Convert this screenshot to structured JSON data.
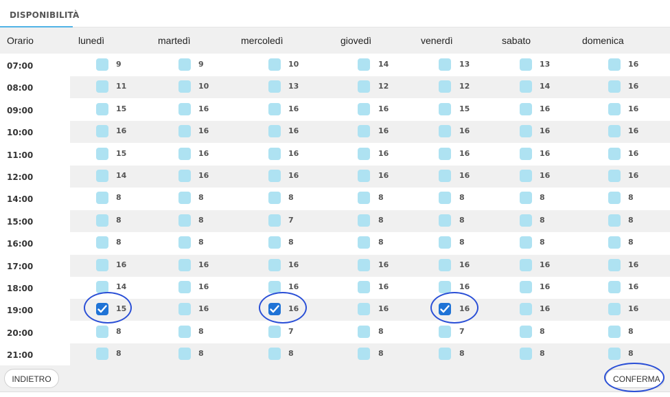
{
  "tab_label": "DISPONIBILITÀ",
  "table": {
    "time_header": "Orario",
    "days": [
      "lunedì",
      "martedì",
      "mercoledì",
      "giovedì",
      "venerdì",
      "sabato",
      "domenica"
    ],
    "rows": [
      {
        "time": "07:00",
        "counts": [
          "9",
          "9",
          "10",
          "14",
          "13",
          "13",
          "16"
        ],
        "checked": [
          false,
          false,
          false,
          false,
          false,
          false,
          false
        ]
      },
      {
        "time": "08:00",
        "counts": [
          "11",
          "10",
          "13",
          "12",
          "12",
          "14",
          "16"
        ],
        "checked": [
          false,
          false,
          false,
          false,
          false,
          false,
          false
        ]
      },
      {
        "time": "09:00",
        "counts": [
          "15",
          "16",
          "16",
          "16",
          "15",
          "16",
          "16"
        ],
        "checked": [
          false,
          false,
          false,
          false,
          false,
          false,
          false
        ]
      },
      {
        "time": "10:00",
        "counts": [
          "16",
          "16",
          "16",
          "16",
          "16",
          "16",
          "16"
        ],
        "checked": [
          false,
          false,
          false,
          false,
          false,
          false,
          false
        ]
      },
      {
        "time": "11:00",
        "counts": [
          "15",
          "16",
          "16",
          "16",
          "16",
          "16",
          "16"
        ],
        "checked": [
          false,
          false,
          false,
          false,
          false,
          false,
          false
        ]
      },
      {
        "time": "12:00",
        "counts": [
          "14",
          "16",
          "16",
          "16",
          "16",
          "16",
          "16"
        ],
        "checked": [
          false,
          false,
          false,
          false,
          false,
          false,
          false
        ]
      },
      {
        "time": "14:00",
        "counts": [
          "8",
          "8",
          "8",
          "8",
          "8",
          "8",
          "8"
        ],
        "checked": [
          false,
          false,
          false,
          false,
          false,
          false,
          false
        ]
      },
      {
        "time": "15:00",
        "counts": [
          "8",
          "8",
          "7",
          "8",
          "8",
          "8",
          "8"
        ],
        "checked": [
          false,
          false,
          false,
          false,
          false,
          false,
          false
        ]
      },
      {
        "time": "16:00",
        "counts": [
          "8",
          "8",
          "8",
          "8",
          "8",
          "8",
          "8"
        ],
        "checked": [
          false,
          false,
          false,
          false,
          false,
          false,
          false
        ]
      },
      {
        "time": "17:00",
        "counts": [
          "16",
          "16",
          "16",
          "16",
          "16",
          "16",
          "16"
        ],
        "checked": [
          false,
          false,
          false,
          false,
          false,
          false,
          false
        ]
      },
      {
        "time": "18:00",
        "counts": [
          "14",
          "16",
          "16",
          "16",
          "16",
          "16",
          "16"
        ],
        "checked": [
          false,
          false,
          false,
          false,
          false,
          false,
          false
        ]
      },
      {
        "time": "19:00",
        "counts": [
          "15",
          "16",
          "16",
          "16",
          "16",
          "16",
          "16"
        ],
        "checked": [
          true,
          false,
          true,
          false,
          true,
          false,
          false
        ]
      },
      {
        "time": "20:00",
        "counts": [
          "8",
          "8",
          "7",
          "8",
          "7",
          "8",
          "8"
        ],
        "checked": [
          false,
          false,
          false,
          false,
          false,
          false,
          false
        ]
      },
      {
        "time": "21:00",
        "counts": [
          "8",
          "8",
          "8",
          "8",
          "8",
          "8",
          "8"
        ],
        "checked": [
          false,
          false,
          false,
          false,
          false,
          false,
          false
        ]
      }
    ]
  },
  "footer": {
    "back_label": "INDIETRO",
    "confirm_label": "CONFERMA"
  },
  "colors": {
    "checkbox_unchecked": "#aee2f2",
    "checkbox_checked": "#1f73d6",
    "highlight_ring": "#2a4fd6",
    "tab_underline": "#4fb3e6"
  }
}
